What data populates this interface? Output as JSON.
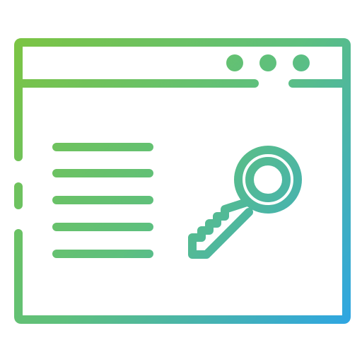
{
  "icon": {
    "name": "browser-window-with-key-icon",
    "gradient": {
      "start": "#7cc443",
      "mid": "#5ec07d",
      "end": "#2fa6e1"
    },
    "text_lines_count": 5,
    "window_dots_count": 3
  }
}
